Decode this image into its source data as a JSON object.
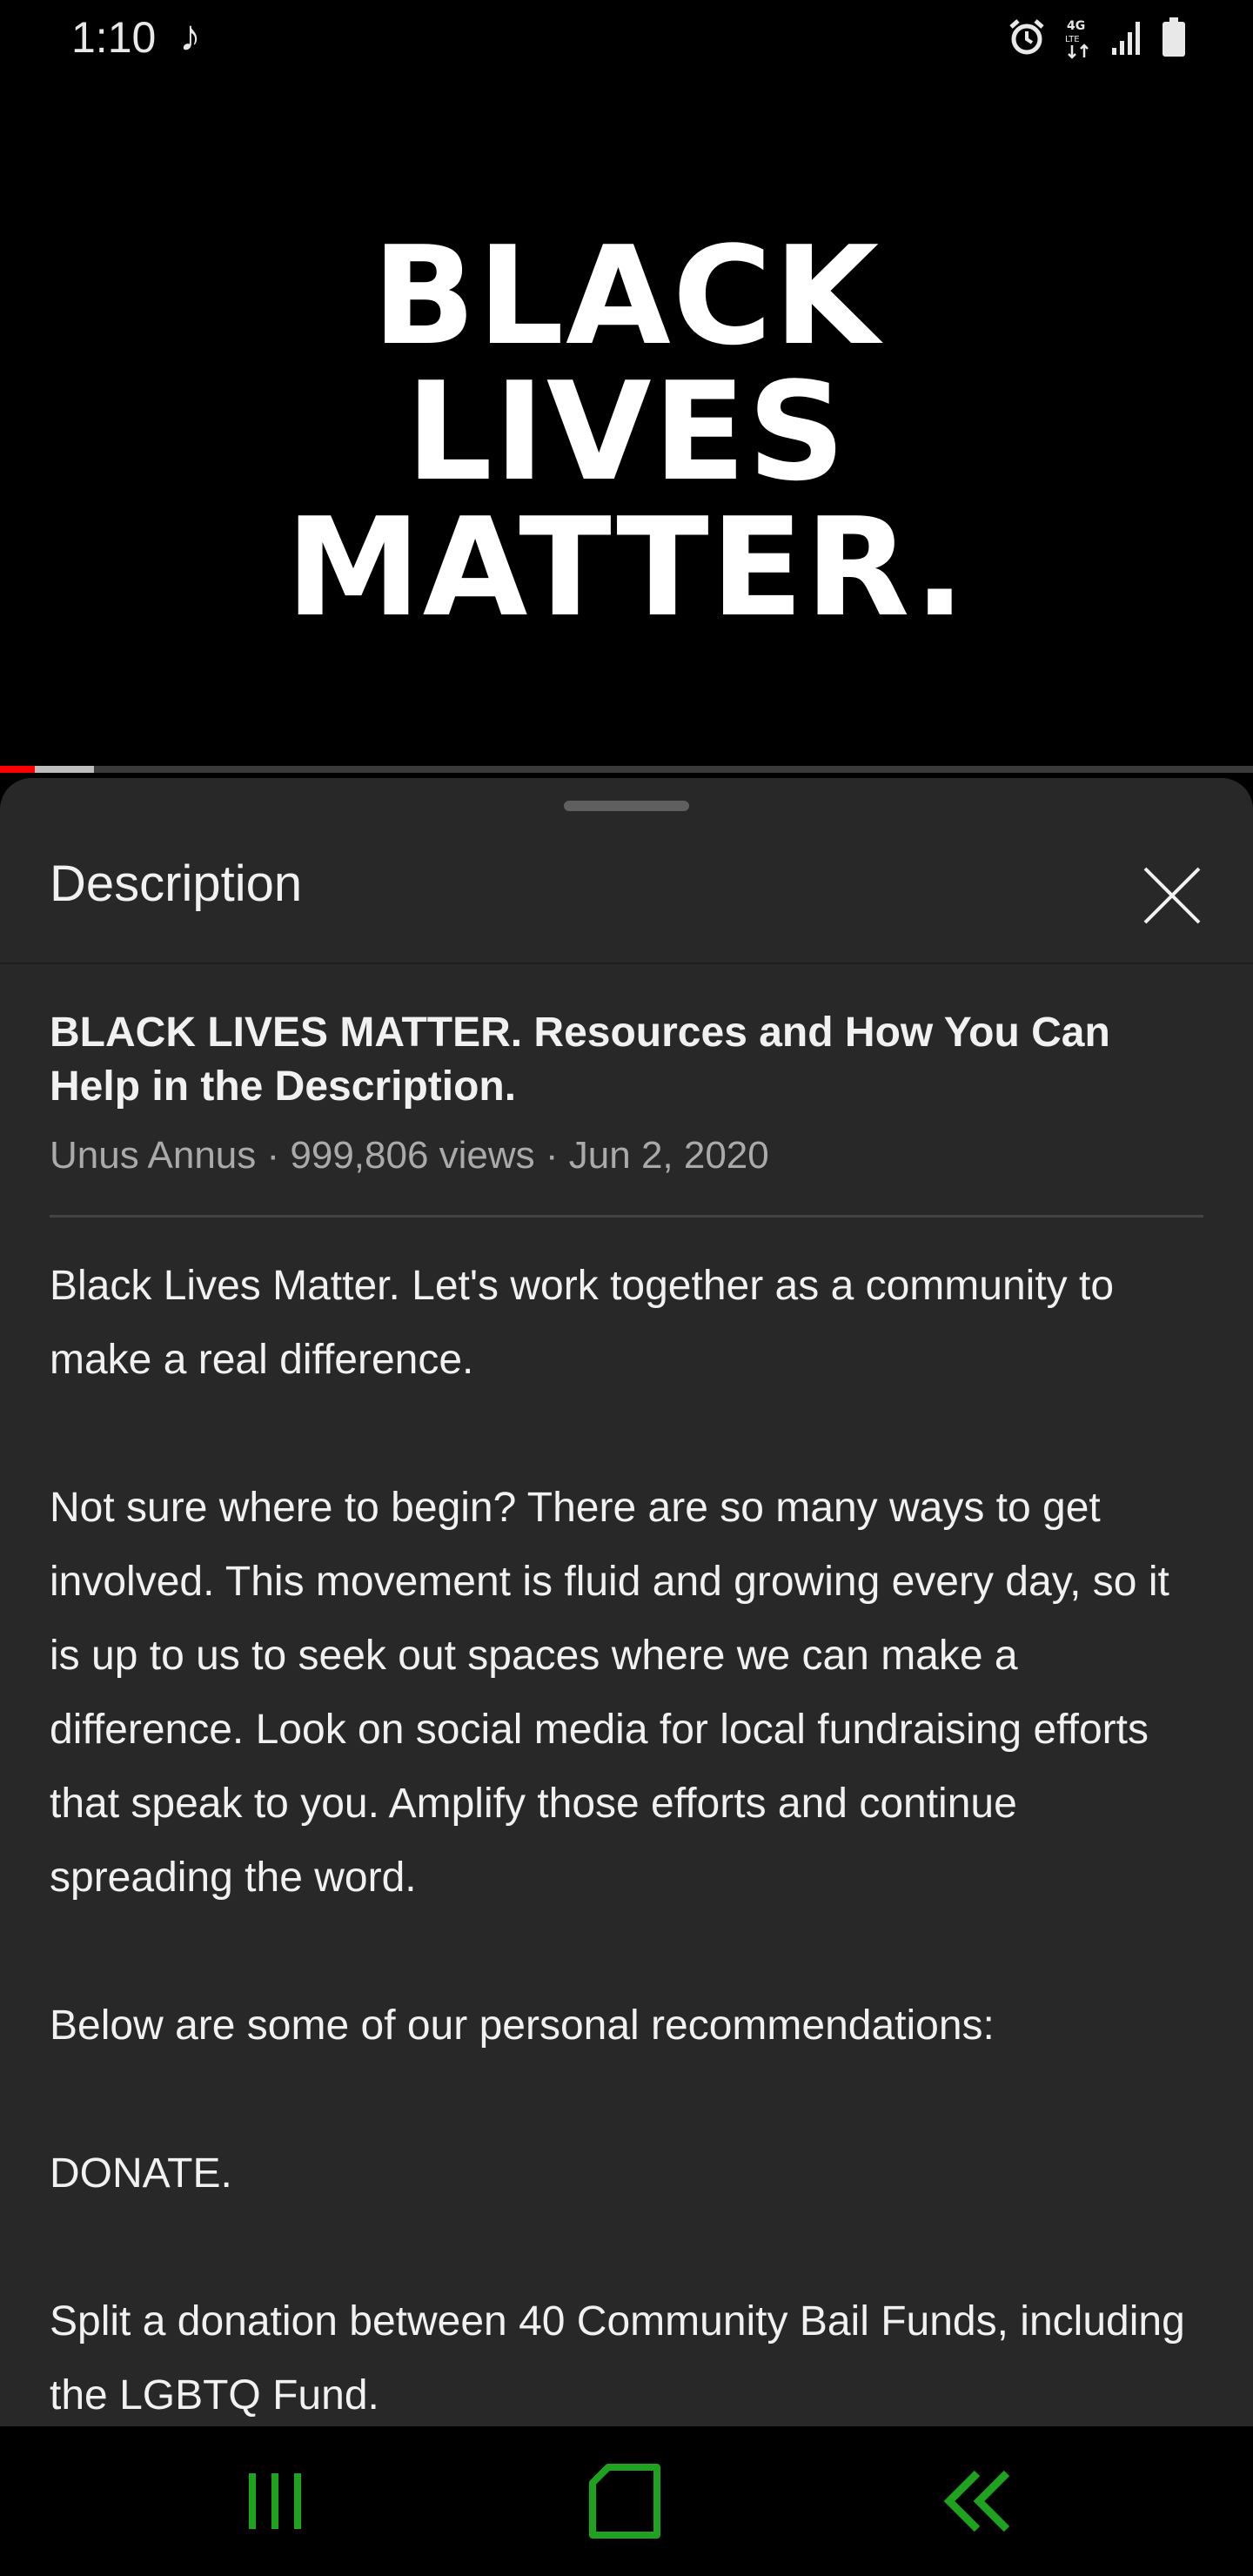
{
  "status_bar": {
    "time": "1:10",
    "music_glyph": "♪",
    "icons": [
      "alarm-icon",
      "4g-lte-data-icon",
      "signal-icon",
      "battery-icon"
    ]
  },
  "video": {
    "overlay_lines": [
      "BLACK",
      "LIVES",
      "MATTER."
    ],
    "progress_played": 0.028,
    "progress_buffered": 0.075,
    "colors": {
      "played": "#ff0000",
      "buffered": "#bdbdbd"
    }
  },
  "sheet": {
    "header_title": "Description",
    "video_title": "BLACK LIVES MATTER. Resources and How You Can Help in the Description.",
    "meta": "Unus Annus · 999,806 views · Jun 2, 2020",
    "paragraphs": [
      "Black Lives Matter. Let's work together as a community to make a real difference.",
      "Not sure where to begin? There are so many ways to get involved. This movement is fluid and growing every day, so it is up to us to seek out spaces where we can make a difference. Look on social media for local fundraising efforts that speak to you. Amplify those efforts and continue spreading the word.",
      "Below are some of our personal recommendations:",
      "DONATE.",
      "Split a donation between 40 Community Bail Funds, including the LGBTQ Fund."
    ]
  },
  "nav_bar": {
    "buttons": [
      "recent-apps-icon",
      "home-icon",
      "back-icon"
    ],
    "color": "#1fa31f"
  }
}
